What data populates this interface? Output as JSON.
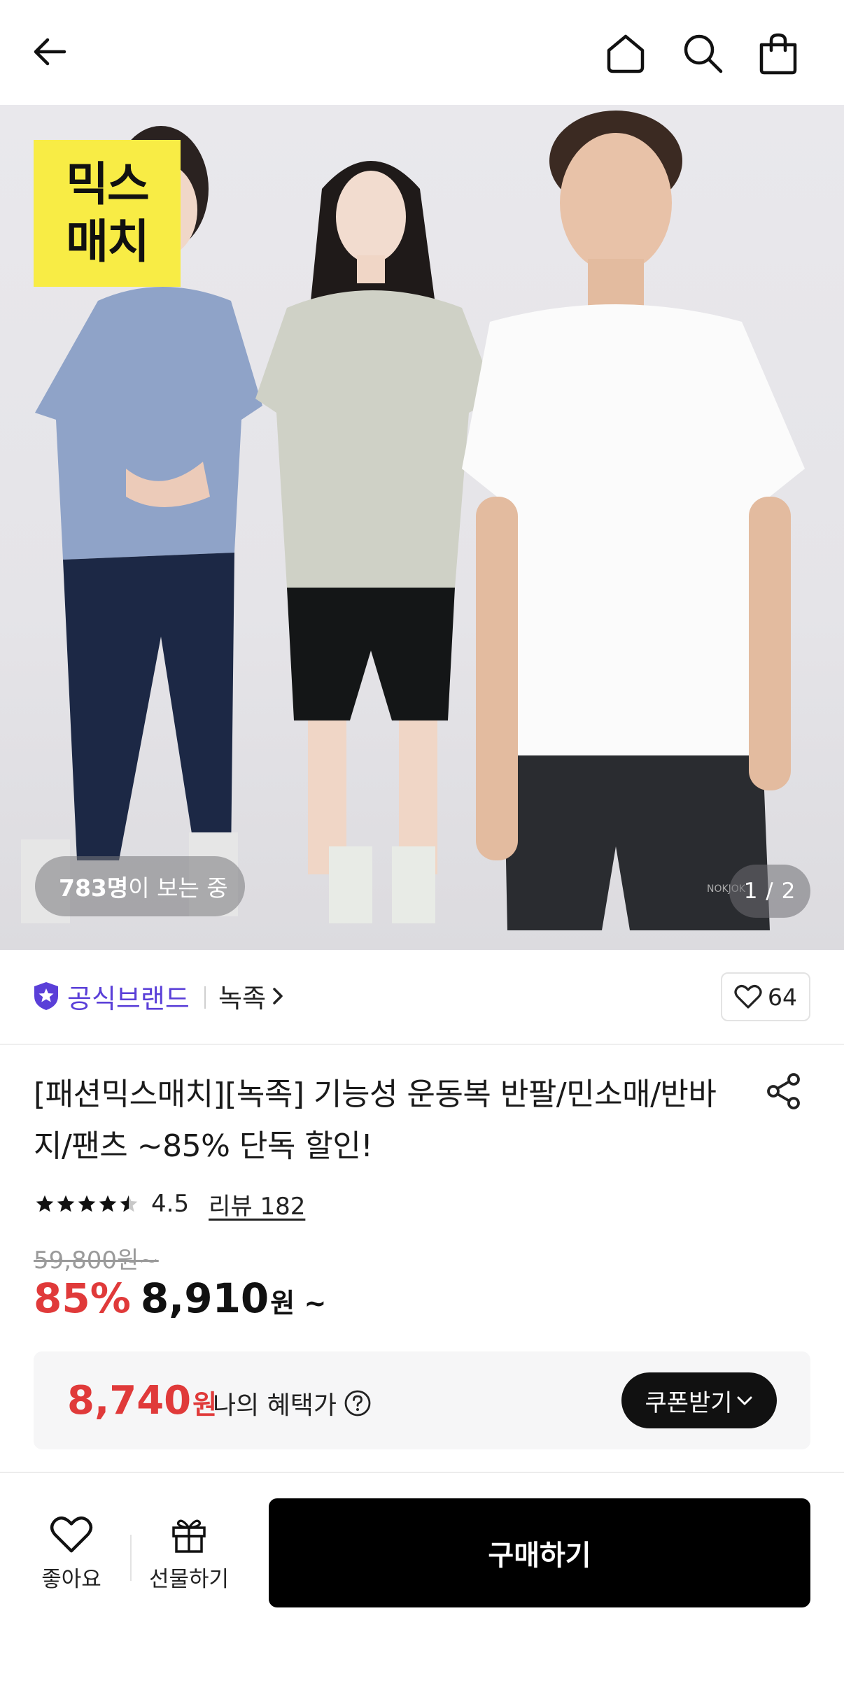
{
  "header": {
    "back_icon": "arrow-left-icon",
    "home_icon": "home-icon",
    "search_icon": "search-icon",
    "cart_icon": "shopping-bag-icon"
  },
  "hero": {
    "badge_line1": "믹스",
    "badge_line2": "매치",
    "badge_color": "#f8ec45",
    "viewer_count": "783명",
    "viewer_suffix": "이 보는 중",
    "page_indicator": "1 / 2",
    "shorts_logo": "NOKJOK"
  },
  "brand": {
    "official_label": "공식브랜드",
    "official_color": "#5a3fd8",
    "brand_name": "녹족",
    "like_count": "64"
  },
  "product": {
    "title": "[패션믹스매치][녹족] 기능성 운동복 반팔/민소매/반바지/팬츠 ~85% 단독 할인!",
    "rating": "4.5",
    "stars": 4.5,
    "review_label": "리뷰 182",
    "original_price": "59,800원~",
    "discount_rate": "85%",
    "sale_price": "8,910",
    "sale_suffix": "원 ~",
    "accent_red": "#e03a3a"
  },
  "benefit": {
    "price": "8,740",
    "price_suffix": "원",
    "label": "나의 혜택가",
    "coupon_button": "쿠폰받기"
  },
  "bottom_bar": {
    "like_label": "좋아요",
    "gift_label": "선물하기",
    "buy_label": "구매하기"
  }
}
